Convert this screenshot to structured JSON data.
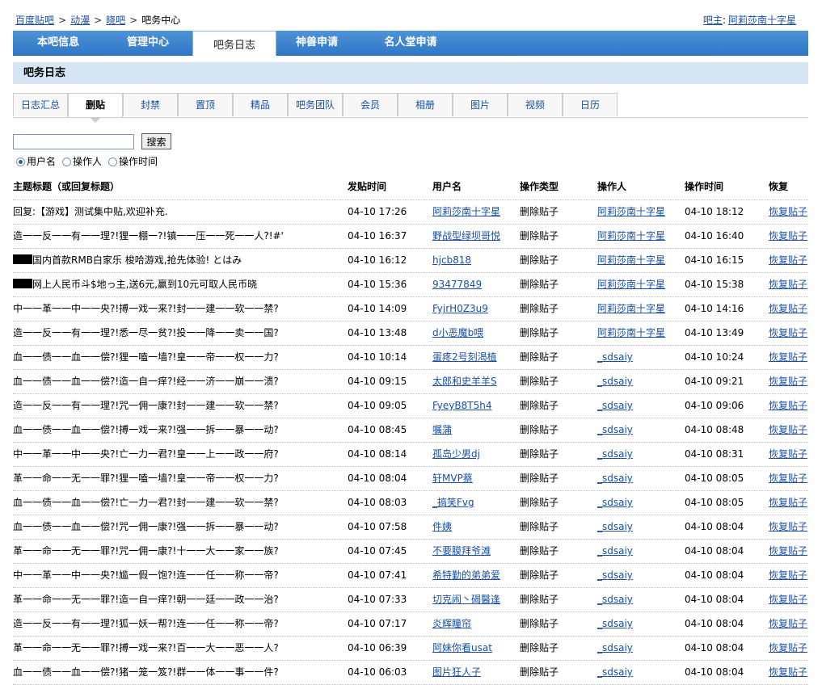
{
  "breadcrumb": [
    "百度贴吧",
    "动漫",
    "晓吧",
    "吧务中心"
  ],
  "owner": {
    "label": "吧主",
    "name": "阿莉莎南十字星"
  },
  "topnav": [
    "本吧信息",
    "管理中心",
    "吧务日志",
    "神兽申请",
    "名人堂申请"
  ],
  "section_title": "吧务日志",
  "subtabs": [
    "日志汇总",
    "删贴",
    "封禁",
    "置顶",
    "精品",
    "吧务团队",
    "会员",
    "相册",
    "图片",
    "视频",
    "日历"
  ],
  "search": {
    "value": "",
    "button": "搜索"
  },
  "radios": [
    "用户名",
    "操作人",
    "操作时间"
  ],
  "columns": [
    "主题标题（或回复标题）",
    "发贴时间",
    "用户名",
    "操作类型",
    "操作人",
    "操作时间",
    "恢复"
  ],
  "rows": [
    {
      "title": "回复:【游戏】测试集中贴,欢迎补充.",
      "redact": false,
      "post_time": "04-10 17:26",
      "user": "阿莉莎南十字星",
      "type": "删除贴子",
      "operator": "阿莉莎南十字星",
      "op_time": "04-10 18:12",
      "restore": "恢复贴子"
    },
    {
      "title": "造一一反一一有一一理?!狸一棚一?!镇一一压一一死一一人?!#'",
      "redact": false,
      "post_time": "04-10 16:37",
      "user": "野战型绿坝哥悦",
      "type": "删除贴子",
      "operator": "阿莉莎南十字星",
      "op_time": "04-10 16:40",
      "restore": "恢复贴子"
    },
    {
      "title": "国内首款RMB白家乐 梭哈游戏,抢先体验! とはみ",
      "redact": true,
      "post_time": "04-10 16:12",
      "user": "hjcb818",
      "type": "删除贴子",
      "operator": "阿莉莎南十字星",
      "op_time": "04-10 16:15",
      "restore": "恢复贴子"
    },
    {
      "title": "网上人民币斗$地っ主,送6元,赢到10元可取人民币晓",
      "redact": true,
      "post_time": "04-10 15:36",
      "user": "93477849",
      "type": "删除贴子",
      "operator": "阿莉莎南十字星",
      "op_time": "04-10 15:38",
      "restore": "恢复贴子"
    },
    {
      "title": "中一一革一一中一一央?!搏一戏一来?!封一一建一一软一一禁?",
      "redact": false,
      "post_time": "04-10 14:09",
      "user": "FyjrH0Z3u9",
      "type": "删除贴子",
      "operator": "阿莉莎南十字星",
      "op_time": "04-10 14:16",
      "restore": "恢复贴子"
    },
    {
      "title": "造一一反一一有一一理?!悉一尽一贫?!投一一降一一卖一一国?",
      "redact": false,
      "post_time": "04-10 13:48",
      "user": "d小恶魔b喂",
      "type": "删除贴子",
      "operator": "阿莉莎南十字星",
      "op_time": "04-10 13:49",
      "restore": "恢复贴子"
    },
    {
      "title": "血一一债一一血一一偿?!狸一嗑一墙?!皇一一帝一一权一一力?",
      "redact": false,
      "post_time": "04-10 10:14",
      "user": "蛋疼2号刻渴植",
      "type": "删除贴子",
      "operator": "_sdsaiy",
      "op_time": "04-10 10:24",
      "restore": "恢复贴子"
    },
    {
      "title": "血一一债一一血一一偿?!造一自一痒?!经一一济一一崩一一溃?",
      "redact": false,
      "post_time": "04-10 09:15",
      "user": "太郎和史羊羊S",
      "type": "删除贴子",
      "operator": "_sdsaiy",
      "op_time": "04-10 09:21",
      "restore": "恢复贴子"
    },
    {
      "title": "造一一反一一有一一理?!咒一佣一康?!封一一建一一软一一禁?",
      "redact": false,
      "post_time": "04-10 09:05",
      "user": "FyeyB8T5h4",
      "type": "删除贴子",
      "operator": "_sdsaiy",
      "op_time": "04-10 09:06",
      "restore": "恢复贴子"
    },
    {
      "title": "血一一债一一血一一偿?!搏一戏一来?!强一一拆一一暴一一动?",
      "redact": false,
      "post_time": "04-10 08:45",
      "user": "嘱蒲",
      "type": "删除贴子",
      "operator": "_sdsaiy",
      "op_time": "04-10 08:48",
      "restore": "恢复贴子"
    },
    {
      "title": "中一一革一一中一一央?!亡一力一君?!皇一一上一一政一一府?",
      "redact": false,
      "post_time": "04-10 08:14",
      "user": "孤岛少男dj",
      "type": "删除贴子",
      "operator": "_sdsaiy",
      "op_time": "04-10 08:31",
      "restore": "恢复贴子"
    },
    {
      "title": "革一一命一一无一一罪?!狸一嗑一墙?!皇一一帝一一权一一力?",
      "redact": false,
      "post_time": "04-10 08:04",
      "user": "轩MVP蔡",
      "type": "删除贴子",
      "operator": "_sdsaiy",
      "op_time": "04-10 08:05",
      "restore": "恢复贴子"
    },
    {
      "title": "血一一债一一血一一偿?!亡一力一君?!封一一建一一软一一禁?",
      "redact": false,
      "post_time": "04-10 08:03",
      "user": "_搞笑Fvg",
      "type": "删除贴子",
      "operator": "_sdsaiy",
      "op_time": "04-10 08:05",
      "restore": "恢复贴子"
    },
    {
      "title": "血一一债一一血一一偿?!咒一佣一康?!强一一拆一一暴一一动?",
      "redact": false,
      "post_time": "04-10 07:58",
      "user": "件姨",
      "type": "删除贴子",
      "operator": "_sdsaiy",
      "op_time": "04-10 08:04",
      "restore": "恢复贴子"
    },
    {
      "title": "革一一命一一无一一罪?!咒一佣一康?!十一一大一一家一一族?",
      "redact": false,
      "post_time": "04-10 07:45",
      "user": "不要膜拜爷滩",
      "type": "删除贴子",
      "operator": "_sdsaiy",
      "op_time": "04-10 08:04",
      "restore": "恢复贴子"
    },
    {
      "title": "中一一革一一中一一央?!尴一假一饱?!连一一任一一称一一帝?",
      "redact": false,
      "post_time": "04-10 07:41",
      "user": "希特勤的弟弟爱",
      "type": "删除贴子",
      "operator": "_sdsaiy",
      "op_time": "04-10 08:04",
      "restore": "恢复贴子"
    },
    {
      "title": "革一一命一一无一一罪?!造一自一痒?!朝一一廷一一政一一治?",
      "redact": false,
      "post_time": "04-10 07:33",
      "user": "切克闹丶碣醫逢",
      "type": "删除贴子",
      "operator": "_sdsaiy",
      "op_time": "04-10 08:04",
      "restore": "恢复贴子"
    },
    {
      "title": "造一一反一一有一一理?!狐一妖一帮?!连一一任一一称一一帝?",
      "redact": false,
      "post_time": "04-10 07:17",
      "user": "炎辉瞳帘",
      "type": "删除贴子",
      "operator": "_sdsaiy",
      "op_time": "04-10 08:04",
      "restore": "恢复贴子"
    },
    {
      "title": "革一一命一一无一一罪?!搏一戏一来?!百一一大一一恶一一人?",
      "redact": false,
      "post_time": "04-10 06:39",
      "user": "阿妹你看usat",
      "type": "删除贴子",
      "operator": "_sdsaiy",
      "op_time": "04-10 08:04",
      "restore": "恢复贴子"
    },
    {
      "title": "血一一债一一血一一偿?!猪一笼一笈?!群一一体一一事一一件?",
      "redact": false,
      "post_time": "04-10 06:03",
      "user": "图片狂人子",
      "type": "删除贴子",
      "operator": "_sdsaiy",
      "op_time": "04-10 08:04",
      "restore": "恢复贴子"
    }
  ]
}
